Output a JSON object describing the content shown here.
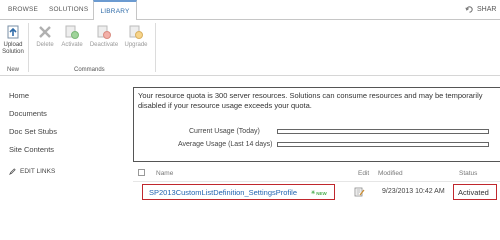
{
  "tabs": {
    "browse": "BROWSE",
    "solutions": "SOLUTIONS",
    "library": "LIBRARY",
    "active": "library"
  },
  "share": {
    "label": "SHAR",
    "icon": "share-icon"
  },
  "ribbon": {
    "upload_label_1": "Upload",
    "upload_label_2": "Solution",
    "delete_label": "Delete",
    "activate_label": "Activate",
    "deactivate_label": "Deactivate",
    "upgrade_label": "Upgrade",
    "group_new": "New",
    "group_commands": "Commands"
  },
  "nav": {
    "items": [
      "Home",
      "Documents",
      "Doc Set Stubs",
      "Site Contents"
    ],
    "edit_links": "EDIT LINKS"
  },
  "quota": {
    "text": "Your resource quota is 300 server resources. Solutions can consume resources and may be temporarily disabled if your resource usage exceeds your quota.",
    "current_label": "Current Usage (Today)",
    "current_fraction": 0,
    "average_label": "Average Usage (Last 14 days)",
    "average_fraction": 0
  },
  "list": {
    "headers": {
      "name": "Name",
      "edit": "Edit",
      "modified": "Modified",
      "status": "Status"
    },
    "rows": [
      {
        "name": "SP2013CustomListDefinition_SettingsProfile",
        "badge": "NEW",
        "modified": "9/23/2013 10:42 AM",
        "status": "Activated"
      }
    ]
  },
  "colors": {
    "accent": "#2f6ba8",
    "link": "#1f63b0",
    "highlight_border": "#c0272d",
    "new_badge": "#4caf50"
  }
}
